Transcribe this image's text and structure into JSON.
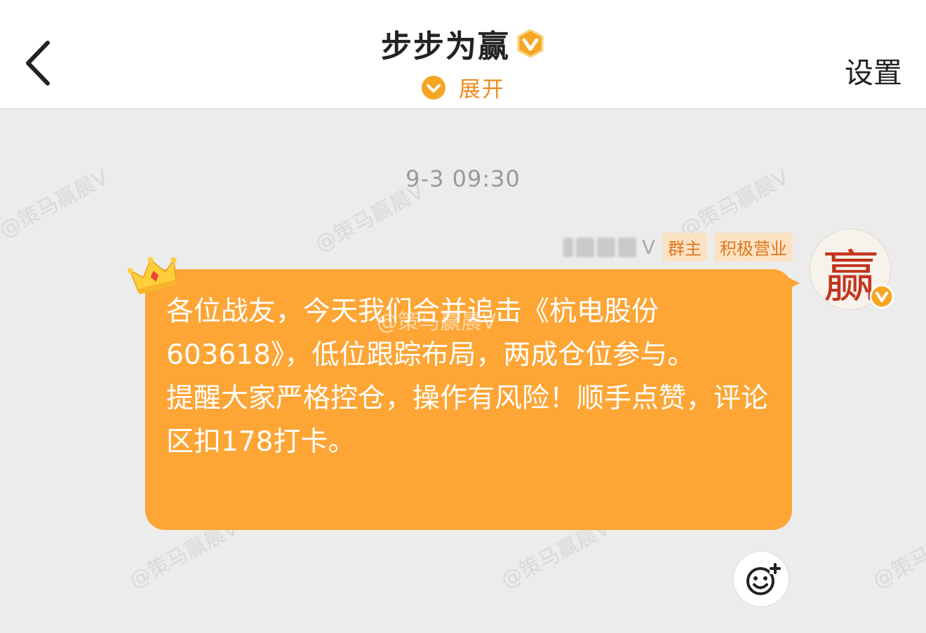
{
  "header": {
    "back_icon": "chevron-left-icon",
    "title": "步步为赢",
    "verified_icon": "vip-badge-icon",
    "expand_label": "展开",
    "settings_label": "设置"
  },
  "chat": {
    "watermarks": [
      "@策马赢晨V",
      "@策马赢晨V",
      "@策马赢晨V",
      "@策马赢晨V",
      "@策马赢晨V",
      "@策马赢晨V"
    ],
    "timestamp": "9-3 09:30",
    "message": {
      "sender_suffix": "V",
      "tags": [
        "群主",
        "积极营业"
      ],
      "avatar_glyph": "赢",
      "text": "各位战友，今天我们合并追击《杭电股份603618》，低位跟踪布局，两成仓位参与。\n提醒大家严格控仓，操作有风险！顺手点赞，评论区扣178打卡。",
      "overlay_watermark": "@策马赢晨V"
    },
    "emoji_icon": "emoji-add-icon"
  },
  "colors": {
    "accent": "#f08a1c",
    "bubble": "#fda535",
    "tag_bg": "#fbe2c4"
  }
}
